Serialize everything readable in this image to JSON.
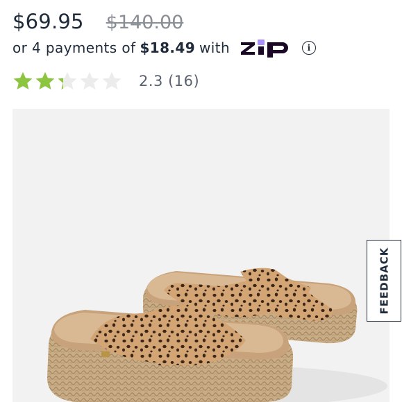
{
  "price": {
    "sale": "$69.95",
    "original": "$140.00"
  },
  "installments": {
    "prefix": "or 4 payments of",
    "amount": "$18.49",
    "suffix": "with",
    "provider_logo": "ZIP",
    "info_icon": "info-icon"
  },
  "rating": {
    "value": 2.3,
    "max": 5,
    "label": "2.3 (16)"
  },
  "image": {
    "alt": "Leopard print espadrille platform slide sandals"
  },
  "feedback": {
    "label": "FEEDBACK"
  },
  "colors": {
    "text": "#1f2a3a",
    "muted": "#8a8f96",
    "star_filled": "#8cc63f",
    "star_empty": "#ececec",
    "zip_purple": "#1a0826",
    "zip_accent": "#aa8fff"
  }
}
